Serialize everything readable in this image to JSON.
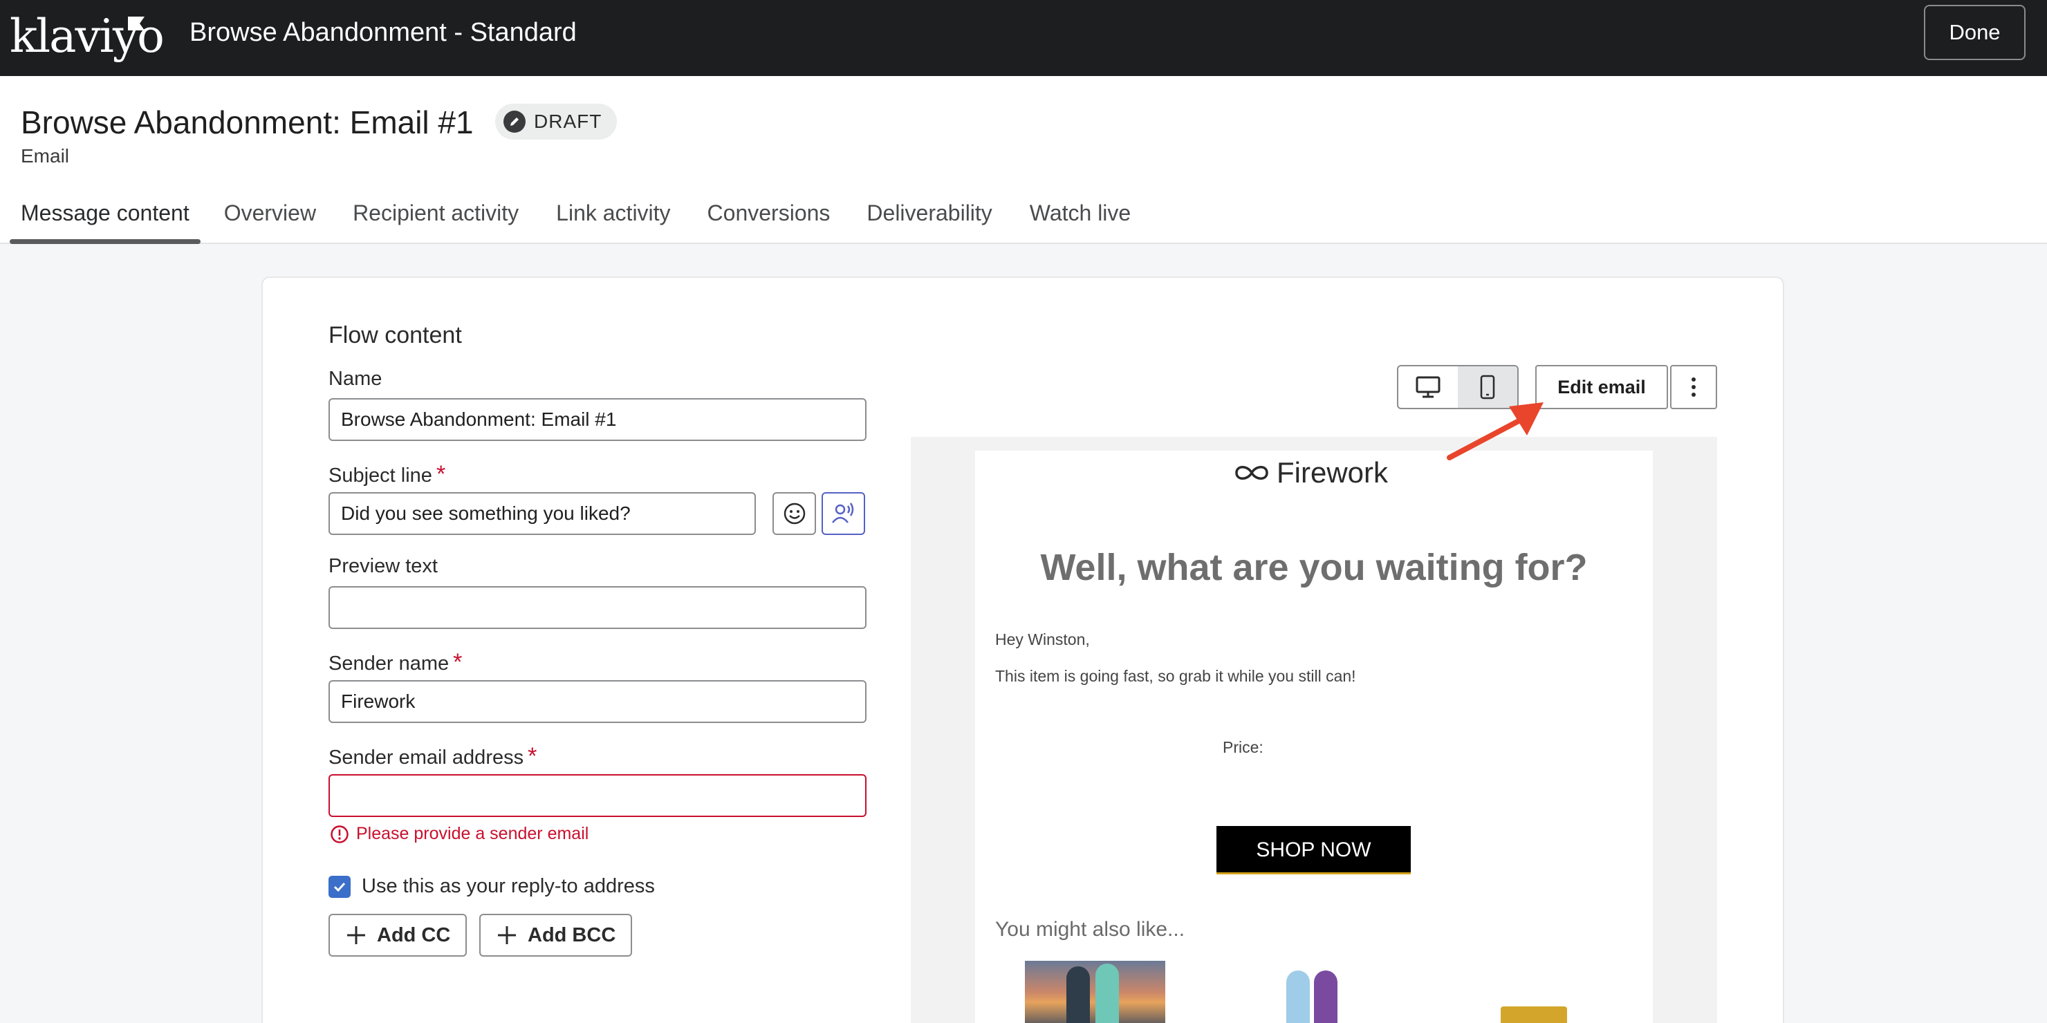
{
  "topbar": {
    "logo_text": "klaviyo",
    "flow_title": "Browse Abandonment - Standard",
    "done_label": "Done"
  },
  "header": {
    "message_title": "Browse Abandonment: Email #1",
    "status_badge": "DRAFT",
    "message_type": "Email",
    "tabs": [
      {
        "label": "Message content",
        "active": true
      },
      {
        "label": "Overview"
      },
      {
        "label": "Recipient activity"
      },
      {
        "label": "Link activity"
      },
      {
        "label": "Conversions"
      },
      {
        "label": "Deliverability"
      },
      {
        "label": "Watch live"
      }
    ]
  },
  "form": {
    "section_title": "Flow content",
    "name": {
      "label": "Name",
      "value": "Browse Abandonment: Email #1"
    },
    "subject": {
      "label": "Subject line",
      "required_mark": "*",
      "value": "Did you see something you liked?"
    },
    "preview_text": {
      "label": "Preview text",
      "value": ""
    },
    "sender_name": {
      "label": "Sender name",
      "required_mark": "*",
      "value": "Firework"
    },
    "sender_email": {
      "label": "Sender email address",
      "required_mark": "*",
      "value": "",
      "error": "Please provide a sender email"
    },
    "reply_to": {
      "label": "Use this as your reply-to address",
      "checked": true
    },
    "add_cc_label": "Add CC",
    "add_bcc_label": "Add BCC"
  },
  "preview": {
    "edit_email_label": "Edit email",
    "brand": "Firework",
    "heading": "Well, what are you waiting for?",
    "greeting": "Hey Winston,",
    "body": "This item is going fast, so grab it while you still can!",
    "price_label": "Price:",
    "cta_label": "SHOP NOW",
    "also_like": "You might also like..."
  },
  "colors": {
    "topbar_bg": "#1d1e20",
    "error": "#c8102e",
    "checkbox": "#3b6fc9",
    "annotation_arrow": "#e8452c"
  }
}
